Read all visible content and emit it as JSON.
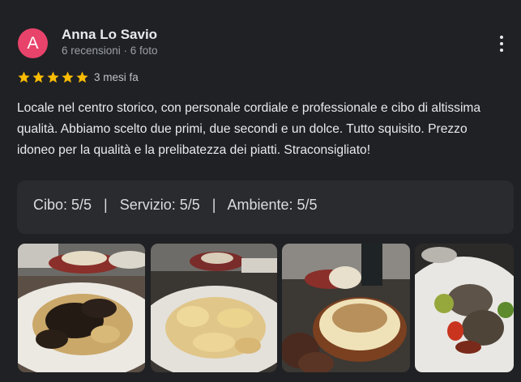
{
  "review": {
    "avatar_letter": "A",
    "avatar_color": "#e8436b",
    "author_name": "Anna Lo Savio",
    "author_meta": "6 recensioni · 6 foto",
    "more_icon": "more-vert-icon",
    "rating": 5,
    "rating_max": 5,
    "star_icon": "star-icon",
    "star_color": "#fbbc04",
    "date": "3 mesi fa",
    "text": "Locale nel centro storico, con personale cordiale e professionale e cibo di altissima qualità. Abbiamo scelto due primi, due secondi e un dolce. Tutto squisito. Prezzo idoneo per la qualità e la prelibatezza dei piatti. Straconsigliato!",
    "ratings_line": "Cibo: 5/5   |   Servizio: 5/5   |   Ambiente: 5/5"
  },
  "photos": [
    {
      "subject": "pasta with black truffle"
    },
    {
      "subject": "ravioli with sauce"
    },
    {
      "subject": "fondue with grated truffle"
    },
    {
      "subject": "meat with vegetables"
    }
  ]
}
